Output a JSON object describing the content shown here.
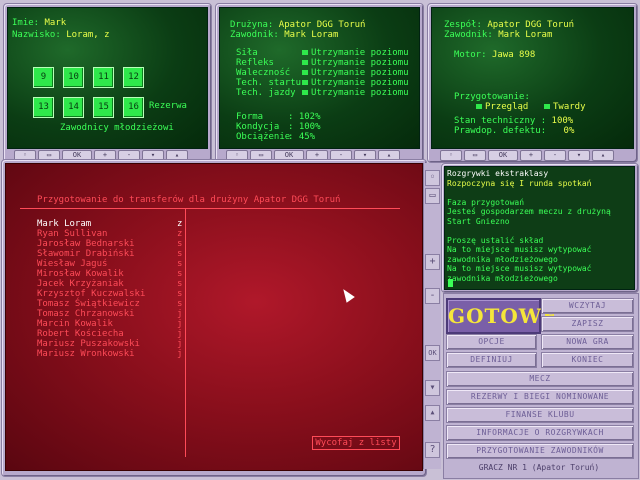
{
  "left_panel": {
    "imie_label": "Imie:",
    "imie_value": "Mark",
    "nazwisko_label": "Nazwisko:",
    "nazwisko_value": "Loram, z",
    "slots_top": [
      "9",
      "10",
      "11",
      "12"
    ],
    "slots_bottom": [
      "13",
      "14",
      "15",
      "16"
    ],
    "rezerwa_label": "Rezerwa",
    "juniors_label": "Zawodnicy młodzieżowi"
  },
  "middle_panel": {
    "druzyna_label": "Drużyna:",
    "druzyna_value": "Apator DGG Toruń",
    "zawodnik_label": "Zawodnik:",
    "zawodnik_value": "Mark Loram",
    "skills": [
      {
        "name": "Siła",
        "value": "Utrzymanie poziomu"
      },
      {
        "name": "Refleks",
        "value": "Utrzymanie poziomu"
      },
      {
        "name": "Waleczność",
        "value": "Utrzymanie poziomu"
      },
      {
        "name": "Tech. startu",
        "value": "Utrzymanie poziomu"
      },
      {
        "name": "Tech. jazdy",
        "value": "Utrzymanie poziomu"
      }
    ],
    "stats": [
      {
        "name": "Forma",
        "value": ": 102%"
      },
      {
        "name": "Kondycja",
        "value": ": 100%"
      },
      {
        "name": "Obciążenie",
        "value": ": 45%"
      }
    ]
  },
  "right_panel": {
    "zespol_label": "Zespół:",
    "zespol_value": "Apator DGG Toruń",
    "zawodnik_label": "Zawodnik:",
    "zawodnik_value": "Mark Loram",
    "motor_label": "Motor:",
    "motor_value": "Jawa 898",
    "przygotowanie_label": "Przygotowanie:",
    "przeglad_label": "Przegląd",
    "twardy_label": "Twardy",
    "stan_label": "Stan techniczny :",
    "stan_value": "100%",
    "awaria_label": "Prawdop. defektu:",
    "awaria_value": "0%"
  },
  "toolbar_labels": [
    "◦",
    "▭",
    "OK",
    "+",
    "-",
    "▾",
    "▴"
  ],
  "transfer_panel": {
    "title": "Przygotowanie do transferów dla drużyny Apator DGG Toruń",
    "players": [
      {
        "name": "Mark Loram",
        "val": "z",
        "selected": true
      },
      {
        "name": "Ryan Sullivan",
        "val": "z"
      },
      {
        "name": "Jarosław Bednarski",
        "val": "s"
      },
      {
        "name": "Sławomir Drabiński",
        "val": "s"
      },
      {
        "name": "Wiesław Jaguś",
        "val": "s"
      },
      {
        "name": "Mirosław Kowalik",
        "val": "s"
      },
      {
        "name": "Jacek Krzyżaniak",
        "val": "s"
      },
      {
        "name": "Krzysztof Kuczwalski",
        "val": "s"
      },
      {
        "name": "Tomasz Świątkiewicz",
        "val": "s"
      },
      {
        "name": "Tomasz Chrzanowski",
        "val": "j"
      },
      {
        "name": "Marcin Kowalik",
        "val": "j"
      },
      {
        "name": "Robert Kościecha",
        "val": "j"
      },
      {
        "name": "Mariusz Puszakowski",
        "val": "j"
      },
      {
        "name": "Mariusz Wronkowski",
        "val": "j"
      }
    ],
    "withdraw_button": "Wycofaj z listy"
  },
  "side_controls": [
    "+",
    "-",
    "OK",
    "?"
  ],
  "message_panel": {
    "lines": [
      {
        "text": "Rozgrywki ekstraklasy",
        "color": "#ffffff"
      },
      {
        "text": "Rozpoczyna się I runda spotkań",
        "color": "#e9ff4a"
      },
      {
        "text": "",
        "color": "#3bff57"
      },
      {
        "text": "Faza przygotowań",
        "color": "#3bff57"
      },
      {
        "text": "Jesteś gospodarzem meczu z drużyną",
        "color": "#3bff57"
      },
      {
        "text": "Start Gniezno",
        "color": "#3bff57"
      },
      {
        "text": "",
        "color": "#3bff57"
      },
      {
        "text": "Proszę ustalić skład",
        "color": "#3bff57"
      },
      {
        "text": "Na to miejsce musisz wytypować",
        "color": "#3bff57"
      },
      {
        "text": "zawodnika młodzieżowego",
        "color": "#3bff57"
      },
      {
        "text": "Na to miejsce musisz wytypować",
        "color": "#3bff57"
      },
      {
        "text": "zawodnika młodzieżowego",
        "color": "#3bff57"
      }
    ]
  },
  "menu": {
    "gotowe": "GOTOWE",
    "wczytaj": "WCZYTAJ",
    "zapisz": "ZAPISZ",
    "opcje": "OPCJE",
    "nowa_gra": "NOWA GRA",
    "definiuj": "DEFINIUJ",
    "koniec": "KONIEC",
    "mecz": "MECZ",
    "rezerwy": "REZERWY I BIEGI NOMINOWANE",
    "finanse": "FINANSE KLUBU",
    "informacje": "INFORMACJE O ROZGRYWKACH",
    "przygotowanie": "PRZYGOTOWANIE ZAWODNIKÓW",
    "status": "GRACZ NR 1    (Apator Toruń)"
  },
  "colors": {
    "green_text": "#3bff57",
    "yellow_text": "#e9ff4a",
    "red_text": "#ff4b58",
    "gotowe": "#f5e63a"
  }
}
